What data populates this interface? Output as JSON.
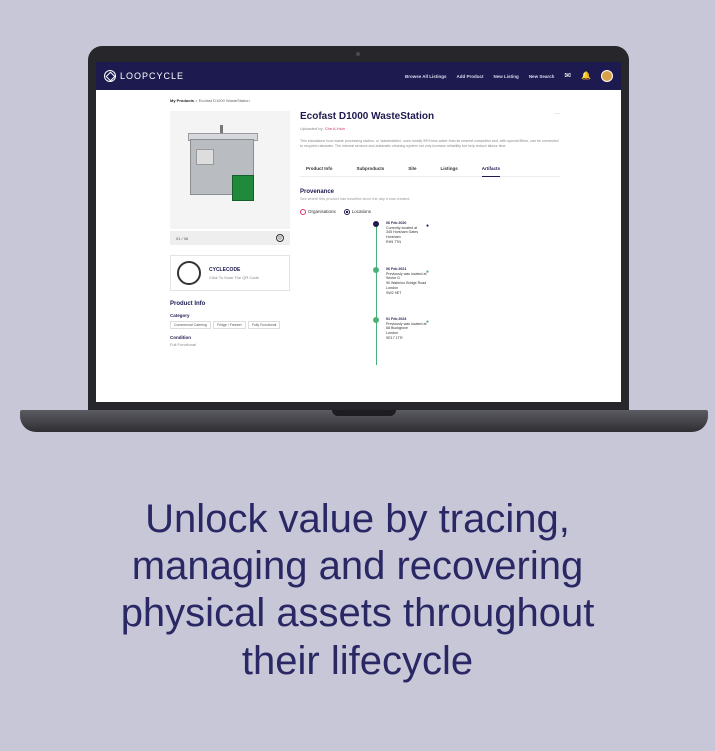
{
  "nav": {
    "brand": "LOOPCYCLE",
    "links": [
      "Browse All Listings",
      "Add Product",
      "New Listing",
      "New Search"
    ]
  },
  "breadcrumb": {
    "root": "My Products",
    "sep": ">",
    "current": "Ecofast D1000 WasteStation"
  },
  "product": {
    "title": "Ecofast D1000 WasteStation",
    "uploaded_by_label": "Uploaded by:",
    "uploaded_by": "Che A-Hsin",
    "description": "This standalone food waste processing station, or 'wastestation', uses mostly 99% less water than its nearest competitor and, with special filters, can be connected to recycled rainwater. The internal sensors and automatic cleaning system not only increase reliability but help reduce labour time.",
    "image_caption": "01 / 06"
  },
  "cyclecode": {
    "title": "CYCLECODE",
    "subtitle": "Click To Scan The QR Code"
  },
  "product_info": {
    "heading": "Product Info",
    "category_label": "Category",
    "categories": [
      "Commercial Catering",
      "Fridge / Freezer",
      "Fully Functional"
    ],
    "condition_label": "Condition",
    "condition": "Full Functional"
  },
  "tabs": [
    "Product Info",
    "Subproducts",
    "Site",
    "Listings",
    "Artifacts"
  ],
  "provenance": {
    "heading": "Provenance",
    "subtitle": "See where this product has travelled since the day it was created.",
    "toggle": [
      "Organisations",
      "Locations"
    ],
    "events": [
      {
        "date": "06 Feb 2020",
        "status": "Currently located at",
        "lines": [
          "345 Horsham Gates",
          "Horsham",
          "RH5 7TN"
        ]
      },
      {
        "date": "06 Feb 2021",
        "status": "Previously was located at",
        "lines": [
          "Sector D",
          "90 Waterloo Bridge Road",
          "London",
          "SW2 9ET"
        ]
      },
      {
        "date": "01 Feb 2023",
        "status": "Previously was located at",
        "lines": [
          "68 Buckgrove",
          "London",
          "SE17 1TR"
        ]
      }
    ]
  },
  "headline": {
    "line1": "Unlock value by tracing,",
    "line2": "managing and recovering",
    "line3": "physical assets throughout",
    "line4": "their lifecycle"
  },
  "colors": {
    "background": "#c8c7d8",
    "navy": "#1c1a4f",
    "accent_green": "#4bb07a",
    "accent_pink": "#d6336c"
  }
}
